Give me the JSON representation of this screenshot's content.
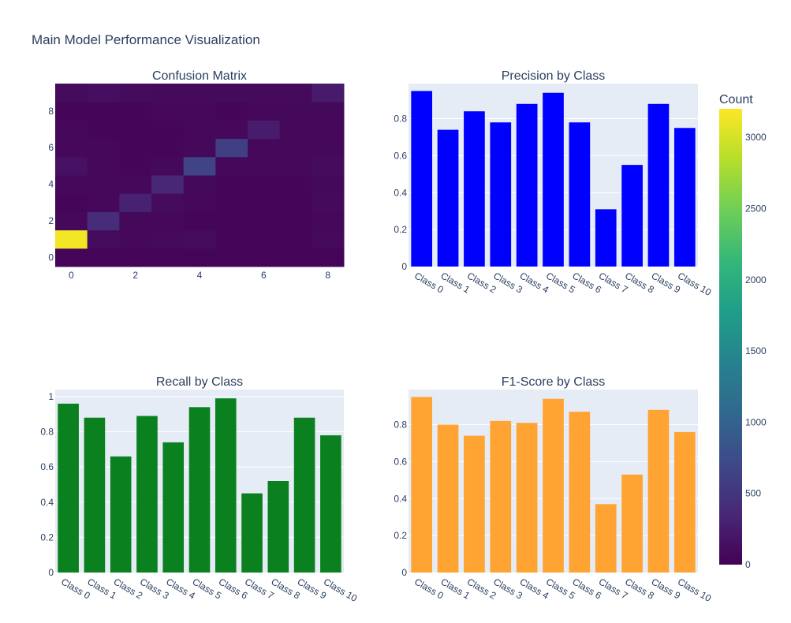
{
  "title": "Main Model Performance Visualization",
  "colors": {
    "precision": "#0000ff",
    "recall": "#0a801f",
    "f1": "#ffa333",
    "plot_bg": "#e5ecf6",
    "text": "#2a3f5f",
    "colorscale": [
      "#440154",
      "#482878",
      "#3e4989",
      "#31688e",
      "#26828e",
      "#1f9e89",
      "#35b779",
      "#6ece58",
      "#b5de2b",
      "#fde725"
    ]
  },
  "chart_data": [
    {
      "type": "heatmap",
      "title": "Confusion Matrix",
      "x": [
        0,
        1,
        2,
        3,
        4,
        5,
        6,
        7,
        8
      ],
      "y": [
        0,
        1,
        2,
        3,
        4,
        5,
        6,
        7,
        8,
        9
      ],
      "x_ticks": [
        0,
        2,
        4,
        6,
        8
      ],
      "y_ticks": [
        0,
        2,
        4,
        6,
        8
      ],
      "z": [
        [
          40,
          40,
          40,
          40,
          40,
          40,
          40,
          40,
          40
        ],
        [
          3150,
          90,
          60,
          80,
          100,
          50,
          40,
          40,
          80
        ],
        [
          60,
          400,
          70,
          60,
          50,
          50,
          40,
          40,
          60
        ],
        [
          50,
          60,
          300,
          90,
          60,
          50,
          40,
          40,
          80
        ],
        [
          60,
          60,
          60,
          350,
          70,
          50,
          40,
          50,
          70
        ],
        [
          150,
          60,
          50,
          70,
          650,
          60,
          60,
          60,
          90
        ],
        [
          60,
          60,
          50,
          50,
          70,
          600,
          60,
          60,
          70
        ],
        [
          60,
          50,
          50,
          50,
          60,
          60,
          250,
          60,
          60
        ],
        [
          50,
          50,
          50,
          60,
          60,
          50,
          60,
          70,
          70
        ],
        [
          100,
          120,
          90,
          80,
          80,
          80,
          80,
          80,
          230
        ]
      ],
      "colorbar": {
        "title": "Count",
        "range": [
          0,
          3200
        ],
        "ticks": [
          0,
          500,
          1000,
          1500,
          2000,
          2500,
          3000
        ]
      }
    },
    {
      "type": "bar",
      "title": "Precision by Class",
      "categories": [
        "Class 0",
        "Class 1",
        "Class 2",
        "Class 3",
        "Class 4",
        "Class 5",
        "Class 6",
        "Class 7",
        "Class 8",
        "Class 9",
        "Class 10"
      ],
      "values": [
        0.95,
        0.74,
        0.84,
        0.78,
        0.88,
        0.94,
        0.78,
        0.31,
        0.55,
        0.88,
        0.75
      ],
      "ylim": [
        0,
        0.99
      ],
      "y_ticks": [
        0,
        0.2,
        0.4,
        0.6,
        0.8
      ]
    },
    {
      "type": "bar",
      "title": "Recall by Class",
      "categories": [
        "Class 0",
        "Class 1",
        "Class 2",
        "Class 3",
        "Class 4",
        "Class 5",
        "Class 6",
        "Class 7",
        "Class 8",
        "Class 9",
        "Class 10"
      ],
      "values": [
        0.96,
        0.88,
        0.66,
        0.89,
        0.74,
        0.94,
        0.99,
        0.45,
        0.52,
        0.88,
        0.78
      ],
      "ylim": [
        0,
        1.04
      ],
      "y_ticks": [
        0,
        0.2,
        0.4,
        0.6,
        0.8,
        1
      ]
    },
    {
      "type": "bar",
      "title": "F1-Score by Class",
      "categories": [
        "Class 0",
        "Class 1",
        "Class 2",
        "Class 3",
        "Class 4",
        "Class 5",
        "Class 6",
        "Class 7",
        "Class 8",
        "Class 9",
        "Class 10"
      ],
      "values": [
        0.95,
        0.8,
        0.74,
        0.82,
        0.81,
        0.94,
        0.87,
        0.37,
        0.53,
        0.88,
        0.76
      ],
      "ylim": [
        0,
        0.99
      ],
      "y_ticks": [
        0,
        0.2,
        0.4,
        0.6,
        0.8
      ]
    }
  ]
}
